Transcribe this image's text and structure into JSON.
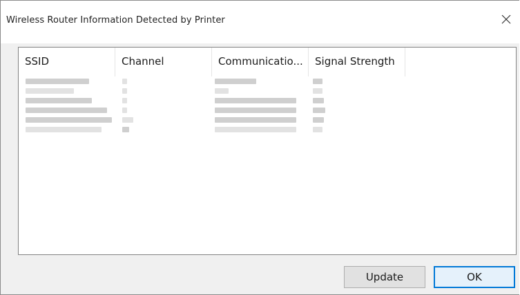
{
  "window": {
    "title": "Wireless Router Information Detected by Printer",
    "close_label": "×"
  },
  "table": {
    "columns": [
      "SSID",
      "Channel",
      "Communicatio...",
      "Signal Strength"
    ],
    "rows_note": "redacted"
  },
  "buttons": {
    "update": "Update",
    "ok": "OK"
  },
  "colors": {
    "ok_border": "#0078d7",
    "dialog_bg": "#f0f0f0"
  }
}
